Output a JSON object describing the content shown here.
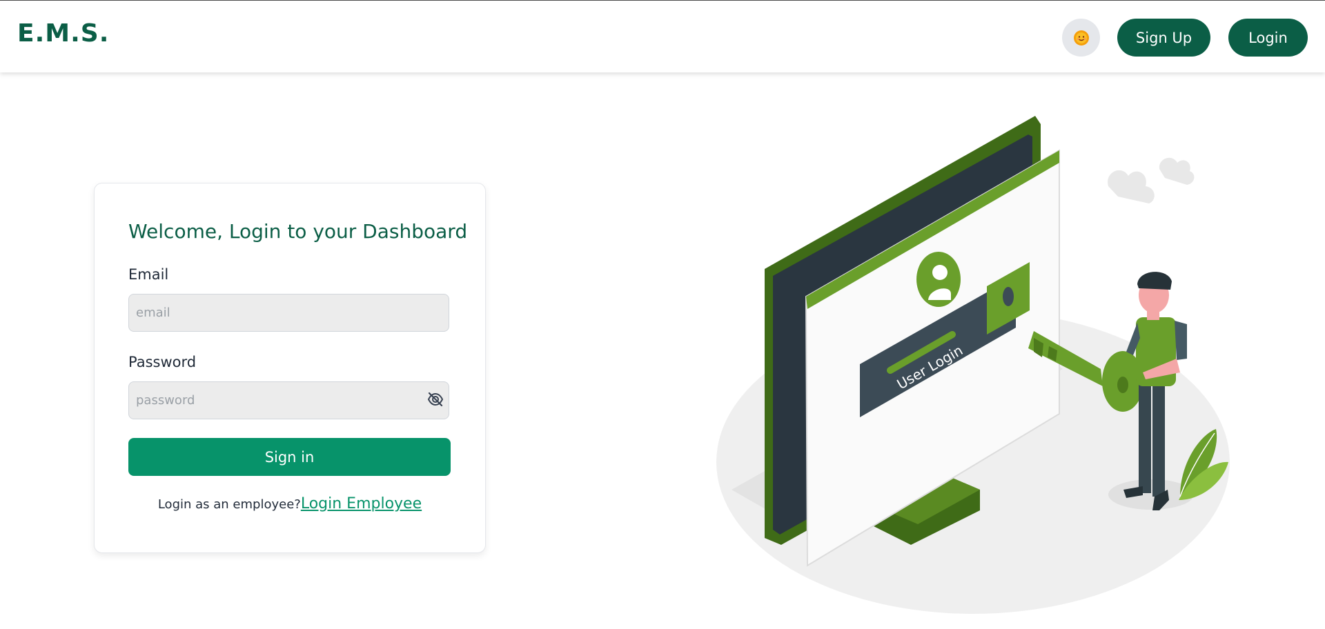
{
  "header": {
    "logo": "E.M.S.",
    "theme_icon": "sun-face-icon",
    "signup_label": "Sign Up",
    "login_label": "Login"
  },
  "login_card": {
    "title": "Welcome, Login to your Dashboard",
    "email_label": "Email",
    "email_placeholder": "email",
    "email_value": "",
    "password_label": "Password",
    "password_placeholder": "password",
    "password_value": "",
    "toggle_icon": "eye-slash-icon",
    "submit_label": "Sign in",
    "footer_text": "Login as an employee?",
    "footer_link": "Login Employee"
  },
  "illustration": {
    "screen_text": "User Login"
  },
  "colors": {
    "brand": "#0b5e46",
    "accent": "#07936a",
    "illustration_green": "#6a9f2b"
  }
}
